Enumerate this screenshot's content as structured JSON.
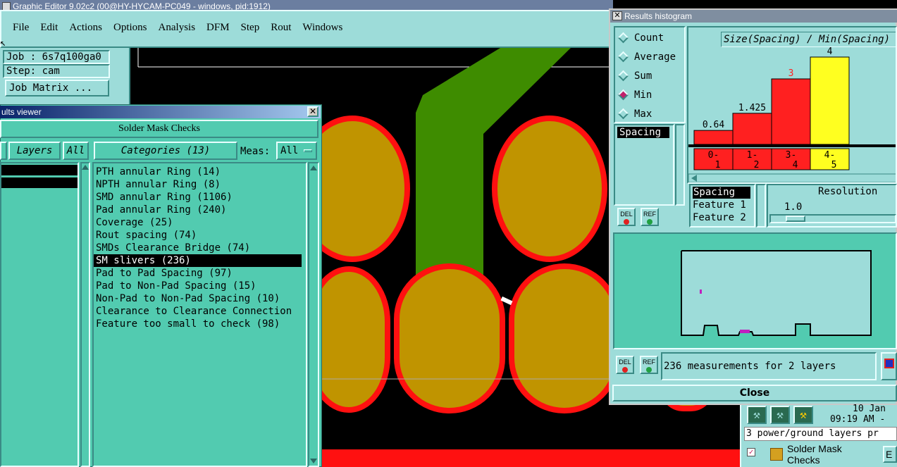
{
  "main_window": {
    "title": "Graphic Editor 9.02c2 (00@HY-HYCAM-PC049 - windows, pid:1912)",
    "menu": [
      "File",
      "Edit",
      "Actions",
      "Options",
      "Analysis",
      "DFM",
      "Step",
      "Rout",
      "Windows"
    ],
    "job_label": "Job : 6s7q100ga0",
    "step_label": "Step: cam",
    "job_matrix_button": "Job Matrix ..."
  },
  "results_viewer": {
    "title": "ults viewer",
    "header": "Solder Mask Checks",
    "layers_button": "Layers",
    "all_button": "All",
    "categories_button": "Categories (13)",
    "meas_label": "Meas:",
    "meas_value": "All",
    "categories": [
      "PTH annular Ring (14)",
      "NPTH annular Ring (8)",
      "SMD annular Ring (1106)",
      "Pad annular Ring (240)",
      "Coverage (25)",
      "Rout spacing (74)",
      "SMDs Clearance Bridge (74)",
      "SM slivers (236)",
      "Pad to Pad Spacing (97)",
      "Pad to Non-Pad Spacing (15)",
      "Non-Pad to Non-Pad Spacing (10)",
      "Clearance to Clearance Connection",
      "Feature too small to check (98)"
    ],
    "selected_category_index": 7
  },
  "histogram": {
    "title": "Results histogram",
    "modes": [
      "Count",
      "Average",
      "Sum",
      "Min",
      "Max"
    ],
    "selected_mode": "Min",
    "list_selected": "Spacing",
    "chart_title": "Size(Spacing) / Min(Spacing)",
    "attr_list": [
      "Spacing",
      "Feature 1",
      "Feature 2"
    ],
    "resolution_label": "Resolution",
    "resolution_value": "1.0",
    "del_label": "DEL",
    "ref_label": "REF",
    "measurements_text": "236 measurements for 2 layers",
    "close_button": "Close",
    "colors": {
      "bar_red": "#ff2020",
      "bar_yellow": "#ffff20",
      "bar_label_red": "#ff2020"
    }
  },
  "chart_data": {
    "type": "bar",
    "title": "Size(Spacing) / Min(Spacing)",
    "categories": [
      "0-1",
      "1-2",
      "3-4",
      "4-5"
    ],
    "values": [
      0.64,
      1.425,
      3,
      4
    ],
    "value_labels": [
      "0.64",
      "1.425",
      "3",
      "4"
    ],
    "colors": [
      "#ff2020",
      "#ff2020",
      "#ff2020",
      "#ffff20"
    ]
  },
  "taskbar": {
    "date": "10 Jan",
    "time": "09:19 AM -",
    "status_message": "3 power/ground layers pr",
    "task_label": "Solder Mask Checks",
    "task_label2": "E"
  }
}
